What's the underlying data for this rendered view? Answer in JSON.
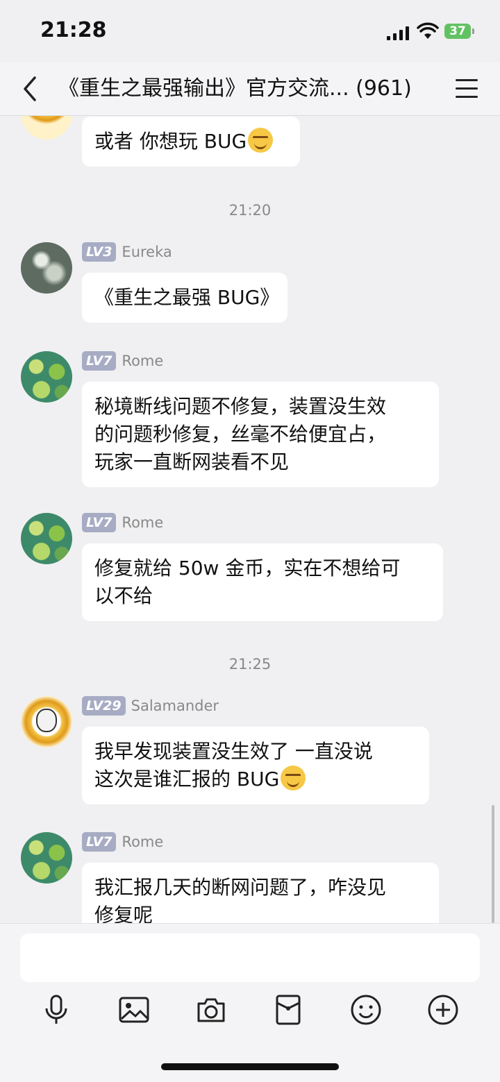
{
  "status": {
    "time": "21:28",
    "battery": "37"
  },
  "header": {
    "title": "《重生之最强输出》官方交流... (961)"
  },
  "messages": [
    {
      "text": "或者 你想玩 BUG",
      "emoji": "smirk-emoji"
    },
    {
      "timestamp": "21:20"
    },
    {
      "level": "LV3",
      "name": "Eureka",
      "text": "《重生之最强 BUG》"
    },
    {
      "level": "LV7",
      "name": "Rome",
      "line1": "秘境断线问题不修复，装置没生效",
      "line2": "的问题秒修复，丝毫不给便宜占，",
      "line3": "玩家一直断网装看不见"
    },
    {
      "level": "LV7",
      "name": "Rome",
      "line1": "修复就给 50w 金币，实在不想给可",
      "line2": "以不给"
    },
    {
      "timestamp": "21:25"
    },
    {
      "level": "LV29",
      "name": "Salamander",
      "line1": "我早发现装置没生效了 一直没说",
      "line2": "这次是谁汇报的 BUG",
      "emoji": "smirk-emoji"
    },
    {
      "level": "LV7",
      "name": "Rome",
      "line1": "我汇报几天的断网问题了，咋没见",
      "line2": "修复呢"
    }
  ],
  "toolbar": [
    "microphone-icon",
    "image-icon",
    "camera-icon",
    "red-packet-icon",
    "emoji-icon",
    "plus-icon"
  ]
}
